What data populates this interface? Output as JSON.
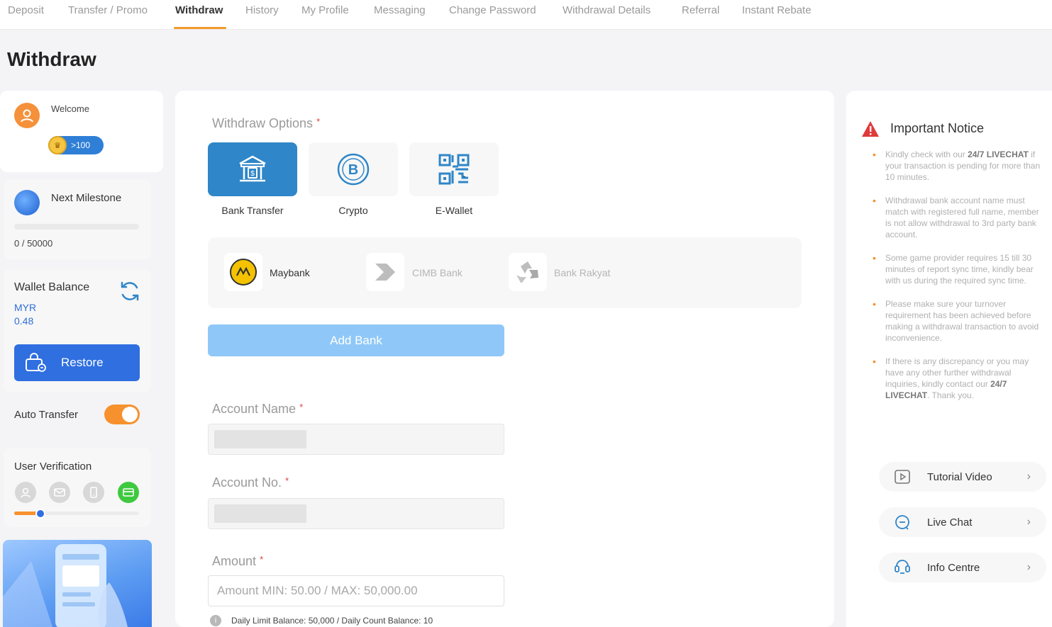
{
  "nav": {
    "tabs": [
      {
        "label": "Deposit"
      },
      {
        "label": "Transfer / Promo"
      },
      {
        "label": "Withdraw"
      },
      {
        "label": "History"
      },
      {
        "label": "My Profile"
      },
      {
        "label": "Messaging"
      },
      {
        "label": "Change Password"
      },
      {
        "label": "Withdrawal Details"
      },
      {
        "label": "Referral"
      },
      {
        "label": "Instant Rebate"
      }
    ],
    "active": "Withdraw"
  },
  "page": {
    "title": "Withdraw"
  },
  "sidebar": {
    "welcome": "Welcome",
    "vip_badge": ">100",
    "milestone": {
      "label": "Next Milestone",
      "value": "0 / 50000",
      "progress": 0
    },
    "wallet": {
      "label": "Wallet Balance",
      "currency": "MYR",
      "amount": "0.48"
    },
    "restore_label": "Restore",
    "auto_transfer": {
      "label": "Auto Transfer",
      "enabled": true
    },
    "verification": {
      "label": "User Verification",
      "verified_count": 1
    }
  },
  "main": {
    "options_label": "Withdraw Options",
    "required_mark": "*",
    "options": [
      {
        "label": "Bank Transfer",
        "icon": "bank-icon",
        "selected": true
      },
      {
        "label": "Crypto",
        "icon": "bitcoin-icon",
        "selected": false
      },
      {
        "label": "E-Wallet",
        "icon": "qr-code-icon",
        "selected": false
      }
    ],
    "banks": [
      {
        "name": "Maybank",
        "icon": "maybank-logo-icon"
      },
      {
        "name": "CIMB Bank",
        "icon": "cimb-logo-icon"
      },
      {
        "name": "Bank Rakyat",
        "icon": "bank-rakyat-logo-icon"
      }
    ],
    "add_bank_label": "Add Bank",
    "account_name_label": "Account Name",
    "account_no_label": "Account No.",
    "amount_label": "Amount",
    "amount_placeholder": "Amount MIN: 50.00 / MAX: 50,000.00",
    "limit_text": "Daily Limit Balance: 50,000 / Daily Count Balance: 10"
  },
  "notice": {
    "title": "Important Notice",
    "items": [
      {
        "pre": "Kindly check with our ",
        "bold": "24/7 LIVECHAT",
        "post": " if your transaction is pending for more than 10 minutes."
      },
      {
        "pre": "Withdrawal bank account name must match with registered full name, member is not allow withdrawal to 3rd party bank account.",
        "bold": "",
        "post": ""
      },
      {
        "pre": "Some game provider requires 15 till 30 minutes of report sync time, kindly bear with us during the required sync time.",
        "bold": "",
        "post": ""
      },
      {
        "pre": "Please make sure your turnover requirement has been achieved before making a withdrawal transaction to avoid inconvenience.",
        "bold": "",
        "post": ""
      },
      {
        "pre": "If there is any discrepancy or you may have any other further withdrawal inquiries, kindly contact our ",
        "bold": "24/7 LIVECHAT",
        "post": ". Thank you."
      }
    ]
  },
  "help": [
    {
      "label": "Tutorial Video",
      "icon": "video-icon"
    },
    {
      "label": "Live Chat",
      "icon": "chat-icon"
    },
    {
      "label": "Info Centre",
      "icon": "info-centre-icon"
    }
  ],
  "colors": {
    "accent": "#f6912e",
    "primary": "#2f6fe0",
    "selected_tile": "#2f86c8"
  }
}
